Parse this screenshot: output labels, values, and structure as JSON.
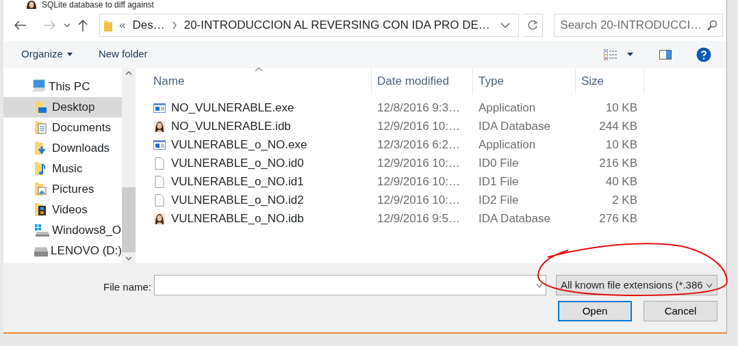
{
  "window": {
    "title": "SQLite database to diff against"
  },
  "address": {
    "overflow": "«",
    "crumbs": [
      "Des…",
      "20-INTRODUCCION AL REVERSING CON IDA PRO DE…"
    ]
  },
  "search": {
    "placeholder": "Search 20-INTRODUCCI…"
  },
  "toolbar": {
    "organize": "Organize",
    "new_folder": "New folder"
  },
  "nav": {
    "items": [
      {
        "label": "This PC",
        "kind": "pc",
        "selected": false,
        "children": [
          {
            "label": "Desktop",
            "kind": "desktop",
            "selected": true
          },
          {
            "label": "Documents",
            "kind": "documents",
            "selected": false
          },
          {
            "label": "Downloads",
            "kind": "downloads",
            "selected": false
          },
          {
            "label": "Music",
            "kind": "music",
            "selected": false
          },
          {
            "label": "Pictures",
            "kind": "pictures",
            "selected": false
          },
          {
            "label": "Videos",
            "kind": "videos",
            "selected": false
          },
          {
            "label": "Windows8_O",
            "kind": "os_drive",
            "selected": false
          },
          {
            "label": "LENOVO (D:)",
            "kind": "drive",
            "selected": false
          }
        ]
      }
    ]
  },
  "table": {
    "columns": [
      "Name",
      "Date modified",
      "Type",
      "Size"
    ],
    "rows": [
      {
        "kind": "app",
        "name": "NO_VULNERABLE.exe",
        "date": "12/8/2016 9:3…",
        "type": "Application",
        "size": "10 KB"
      },
      {
        "kind": "ida",
        "name": "NO_VULNERABLE.idb",
        "date": "12/9/2016 10:…",
        "type": "IDA Database",
        "size": "244 KB"
      },
      {
        "kind": "app",
        "name": "VULNERABLE_o_NO.exe",
        "date": "12/3/2016 6:2…",
        "type": "Application",
        "size": "10 KB"
      },
      {
        "kind": "file",
        "name": "VULNERABLE_o_NO.id0",
        "date": "12/9/2016 10:…",
        "type": "ID0 File",
        "size": "216 KB"
      },
      {
        "kind": "file",
        "name": "VULNERABLE_o_NO.id1",
        "date": "12/9/2016 10:…",
        "type": "ID1 File",
        "size": "40 KB"
      },
      {
        "kind": "file",
        "name": "VULNERABLE_o_NO.id2",
        "date": "12/9/2016 10:…",
        "type": "ID2 File",
        "size": "2 KB"
      },
      {
        "kind": "ida",
        "name": "VULNERABLE_o_NO.idb",
        "date": "12/9/2016 9:5…",
        "type": "IDA Database",
        "size": "276 KB"
      }
    ]
  },
  "footer": {
    "file_name_label": "File name:",
    "filter": "All known file extensions (*.386",
    "buttons": [
      {
        "label": "Open",
        "default": true
      },
      {
        "label": "Cancel",
        "default": false
      }
    ]
  }
}
